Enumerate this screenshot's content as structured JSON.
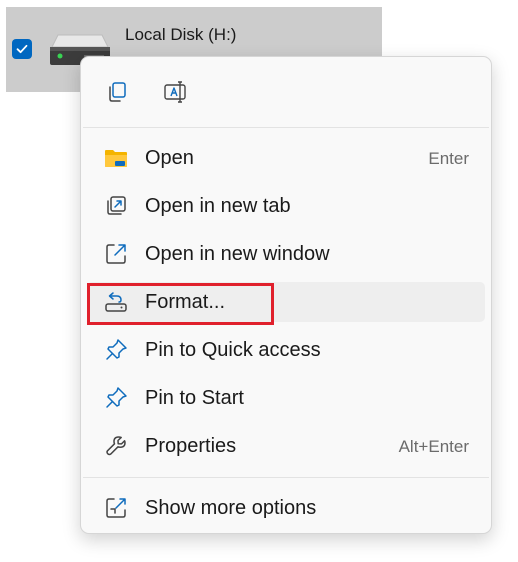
{
  "drive": {
    "label": "Local Disk (H:)",
    "selected": true,
    "icon": "hard-drive-icon"
  },
  "quick_actions": [
    {
      "name": "copy-button",
      "icon": "copy-icon"
    },
    {
      "name": "rename-button",
      "icon": "rename-icon"
    }
  ],
  "menu": {
    "open": {
      "label": "Open",
      "shortcut": "Enter",
      "icon": "folder-icon"
    },
    "open_new_tab": {
      "label": "Open in new tab",
      "icon": "new-tab-icon"
    },
    "open_new_window": {
      "label": "Open in new window",
      "icon": "new-window-icon"
    },
    "format": {
      "label": "Format...",
      "icon": "format-drive-icon"
    },
    "pin_quick_access": {
      "label": "Pin to Quick access",
      "icon": "pin-icon"
    },
    "pin_start": {
      "label": "Pin to Start",
      "icon": "pin-icon"
    },
    "properties": {
      "label": "Properties",
      "shortcut": "Alt+Enter",
      "icon": "wrench-icon"
    },
    "show_more": {
      "label": "Show more options",
      "icon": "show-more-icon"
    }
  },
  "colors": {
    "accent": "#0067c0",
    "highlight": "#e0202c",
    "folder": "#f6c342"
  }
}
